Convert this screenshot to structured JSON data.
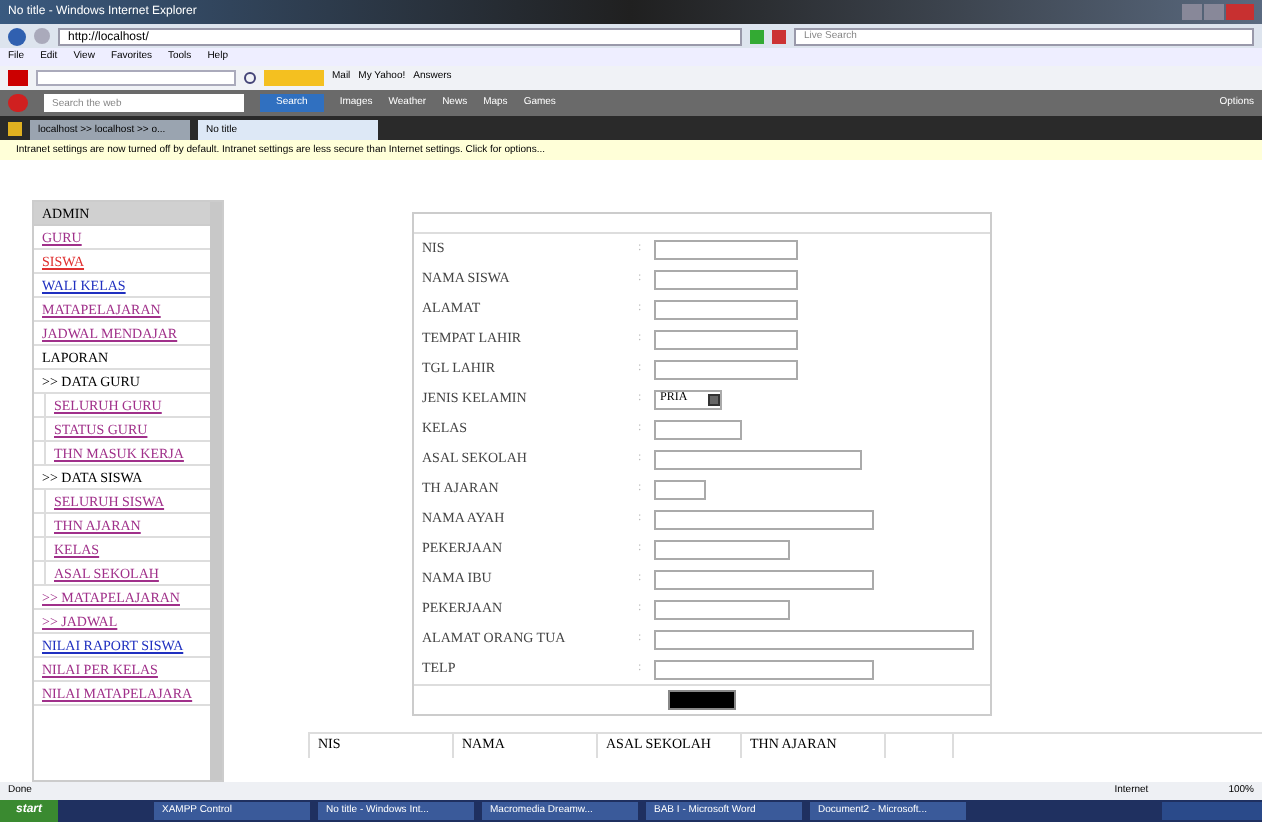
{
  "window": {
    "title": "No title - Windows Internet Explorer"
  },
  "address_bar": {
    "url": "http://localhost/",
    "search_placeholder": "Live Search"
  },
  "menu": [
    "File",
    "Edit",
    "View",
    "Favorites",
    "Tools",
    "Help"
  ],
  "yahoo_toolbar": {
    "items": [
      "Mail",
      "My Yahoo!",
      "Answers"
    ]
  },
  "search_toolbar": {
    "placeholder": "Search the web",
    "button": "Search",
    "items": [
      "Images",
      "Weather",
      "News",
      "Maps",
      "Games"
    ],
    "options": "Options"
  },
  "tabs": [
    {
      "label": "localhost >> localhost >> o...",
      "selected": false
    },
    {
      "label": "No title",
      "selected": true
    }
  ],
  "info_bar": "Intranet settings are now turned off by default. Intranet settings are less secure than Internet settings. Click for options...",
  "sidebar": [
    {
      "kind": "header",
      "label": "ADMIN"
    },
    {
      "kind": "link",
      "label": "GURU",
      "color": "#a0308a"
    },
    {
      "kind": "link",
      "label": "SISWA",
      "color": "#e03030"
    },
    {
      "kind": "link",
      "label": "WALI KELAS",
      "color": "#2030c0"
    },
    {
      "kind": "link",
      "label": "MATAPELAJARAN",
      "color": "#a0308a"
    },
    {
      "kind": "link",
      "label": "JADWAL MENDAJAR",
      "color": "#a0308a"
    },
    {
      "kind": "plain",
      "label": "LAPORAN"
    },
    {
      "kind": "plain",
      "label": ">> DATA GURU"
    },
    {
      "kind": "sub",
      "label": "SELURUH GURU",
      "color": "#a0308a"
    },
    {
      "kind": "sub",
      "label": "STATUS GURU",
      "color": "#a0308a"
    },
    {
      "kind": "sub",
      "label": "THN MASUK KERJA",
      "color": "#a0308a"
    },
    {
      "kind": "plain",
      "label": ">> DATA SISWA"
    },
    {
      "kind": "sub",
      "label": "SELURUH SISWA",
      "color": "#a0308a"
    },
    {
      "kind": "sub",
      "label": "THN AJARAN",
      "color": "#a0308a"
    },
    {
      "kind": "sub",
      "label": "KELAS",
      "color": "#a0308a"
    },
    {
      "kind": "sub",
      "label": "ASAL SEKOLAH",
      "color": "#a0308a"
    },
    {
      "kind": "link",
      "label": ">> MATAPELAJARAN",
      "color": "#a0308a"
    },
    {
      "kind": "link",
      "label": ">> JADWAL",
      "color": "#a0308a"
    },
    {
      "kind": "link",
      "label": "NILAI RAPORT SISWA",
      "color": "#2030c0"
    },
    {
      "kind": "link",
      "label": "NILAI PER KELAS",
      "color": "#a0308a"
    },
    {
      "kind": "link",
      "label": "NILAI MATAPELAJARA",
      "color": "#a0308a"
    }
  ],
  "form": [
    {
      "kind": "text",
      "label": "NIS",
      "separator": ":"
    },
    {
      "kind": "text",
      "label": "NAMA SISWA",
      "separator": ":"
    },
    {
      "kind": "text",
      "label": "ALAMAT",
      "separator": ":"
    },
    {
      "kind": "text",
      "label": "TEMPAT LAHIR",
      "separator": ":"
    },
    {
      "kind": "text",
      "label": "TGL LAHIR",
      "separator": ":"
    },
    {
      "kind": "select",
      "label": "JENIS KELAMIN",
      "separator": ":",
      "value": "PRIA"
    },
    {
      "kind": "text",
      "label": "KELAS",
      "separator": ":"
    },
    {
      "kind": "text",
      "label": "ASAL SEKOLAH",
      "separator": ":"
    },
    {
      "kind": "text",
      "label": "TH AJARAN",
      "separator": ":"
    },
    {
      "kind": "text",
      "label": "NAMA AYAH",
      "separator": ":"
    },
    {
      "kind": "text",
      "label": "PEKERJAAN",
      "separator": ":"
    },
    {
      "kind": "text",
      "label": "NAMA IBU",
      "separator": ":"
    },
    {
      "kind": "text",
      "label": "PEKERJAAN",
      "separator": ":"
    },
    {
      "kind": "text",
      "label": "ALAMAT ORANG TUA",
      "separator": ":"
    },
    {
      "kind": "text",
      "label": "TELP",
      "separator": ":"
    }
  ],
  "table": {
    "columns": [
      "NIS",
      "NAMA",
      "ASAL SEKOLAH",
      "THN AJARAN"
    ]
  },
  "status_bar": {
    "text": "Done",
    "zone": "Internet",
    "zoom": "100%"
  },
  "taskbar": {
    "start": "start",
    "items": [
      "XAMPP Control",
      "No title - Windows Int...",
      "Macromedia Dreamw...",
      "BAB I - Microsoft Word",
      "Document2 - Microsoft..."
    ]
  }
}
